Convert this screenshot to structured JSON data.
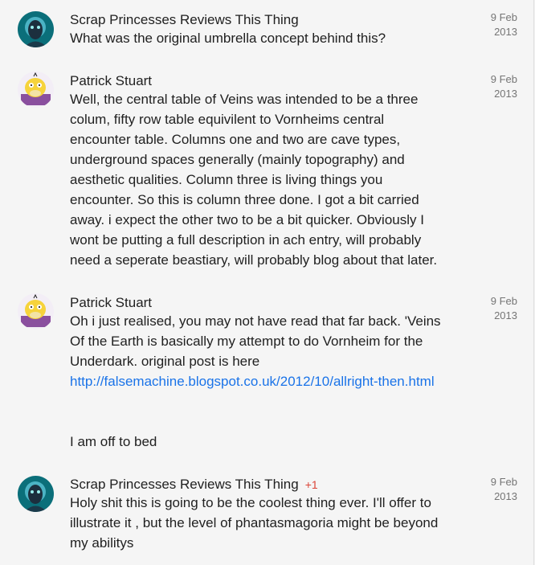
{
  "comments": [
    {
      "author": "Scrap Princesses Reviews This Thing",
      "plus": "",
      "date_day": "9 Feb",
      "date_year": "2013",
      "lines": [
        "What was the original umbrella concept behind this?"
      ]
    },
    {
      "author": "Patrick Stuart",
      "plus": "",
      "date_day": "9 Feb",
      "date_year": "2013",
      "lines": [
        "Well, the central table of Veins was intended to be a three",
        "colum, fifty row table equivilent to Vornheims central",
        "encounter table. Columns one and two are cave types,",
        "underground spaces generally (mainly topography) and",
        "aesthetic qualities. Column three is living things you",
        "encounter. So this is column three done. I got a bit carried",
        "away. i expect the other two to be a bit quicker. Obviously I",
        "wont be putting a full description in ach entry, will probably",
        "need a seperate beastiary, will probably blog about that later."
      ]
    },
    {
      "author": "Patrick Stuart",
      "plus": "",
      "date_day": "9 Feb",
      "date_year": "2013",
      "lines": [
        "Oh i just realised, you may not have read that far back. 'Veins",
        "Of the Earth is basically my attempt to do Vornheim for the",
        "Underdark. original post is here"
      ],
      "link": "http://falsemachine.blogspot.co.uk/2012/10/allright-then.html",
      "after_link": "I am off to bed"
    },
    {
      "author": "Scrap Princesses Reviews This Thing",
      "plus": "+1",
      "date_day": "9 Feb",
      "date_year": "2013",
      "lines": [
        "Holy shit this is going to be the coolest thing ever. I'll offer to",
        "illustrate it , but the level of phantasmagoria might be beyond",
        "my abilitys"
      ]
    }
  ],
  "colors": {
    "link": "#1a73e8",
    "plus": "#db4437",
    "date": "#757575"
  }
}
